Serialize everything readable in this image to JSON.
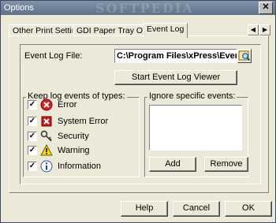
{
  "window": {
    "title": "Options",
    "watermark": "SOFTPEDIA",
    "close_glyph": "✕"
  },
  "tabs": [
    {
      "label": "Other Print Settings"
    },
    {
      "label": "GDI Paper Tray Offset"
    },
    {
      "label": "Event Log"
    }
  ],
  "tab_scroll": {
    "left_glyph": "◀",
    "right_glyph": "▶"
  },
  "event_log": {
    "file_label": "Event Log File:",
    "file_path": "C:\\Program Files\\xPress\\Even",
    "start_viewer_label": "Start Event Log Viewer"
  },
  "keep_group": {
    "label": "Keep log events of types:",
    "check_glyph": "✓",
    "items": [
      {
        "label": "Error",
        "icon": "error-icon",
        "checked": true
      },
      {
        "label": "System Error",
        "icon": "system-error-icon",
        "checked": true
      },
      {
        "label": "Security",
        "icon": "key-icon",
        "checked": true
      },
      {
        "label": "Warning",
        "icon": "warning-icon",
        "checked": true
      },
      {
        "label": "Information",
        "icon": "information-icon",
        "checked": true
      }
    ]
  },
  "ignore_group": {
    "label": "Ignore specific events:",
    "add_label": "Add",
    "remove_label": "Remove"
  },
  "footer": {
    "help_label": "Help",
    "cancel_label": "Cancel",
    "ok_label": "OK"
  }
}
